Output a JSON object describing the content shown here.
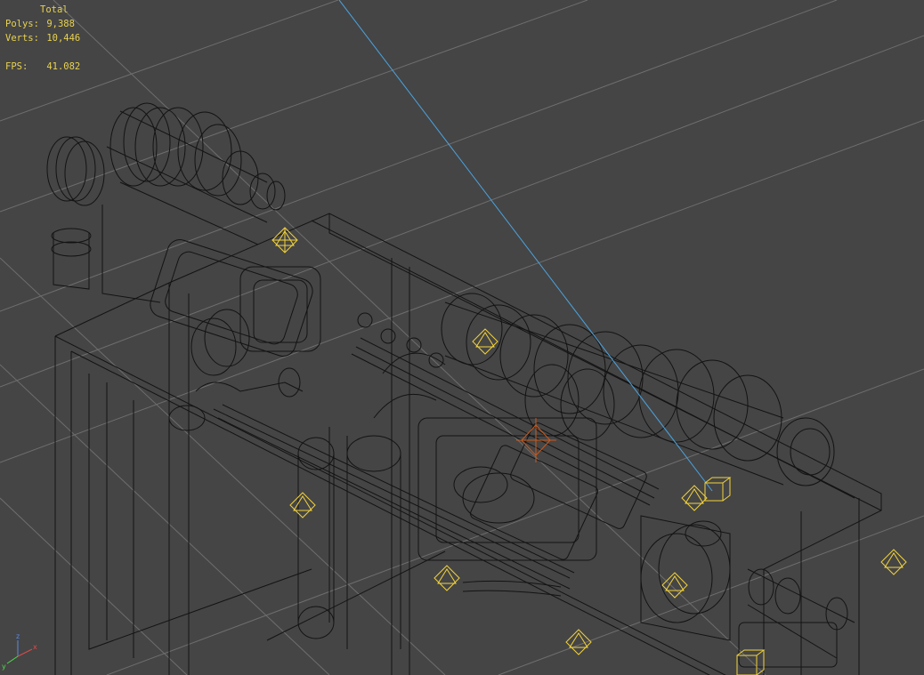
{
  "viewport": {
    "name": "Perspective wireframe viewport",
    "background_color": "#454545",
    "grid_color": "#6e6e6e",
    "wire_color": "#111111",
    "light_helper_color": "#f2d23c",
    "camera_target_color": "#c85a1e",
    "target_line_color": "#4aa3df"
  },
  "stats": {
    "header": "Total",
    "polys_label": "Polys:",
    "polys_value": "9,388",
    "verts_label": "Verts:",
    "verts_value": "10,446",
    "fps_label": "FPS:",
    "fps_value": "41.082"
  },
  "axis_gizmo": {
    "x_label": "x",
    "y_label": "y",
    "z_label": "z",
    "x_color": "#e04a4a",
    "y_color": "#4ae04a",
    "z_color": "#5a8ae0"
  },
  "icons": {
    "light_helper": "octahedron-light-icon",
    "camera_target": "camera-target-icon"
  }
}
